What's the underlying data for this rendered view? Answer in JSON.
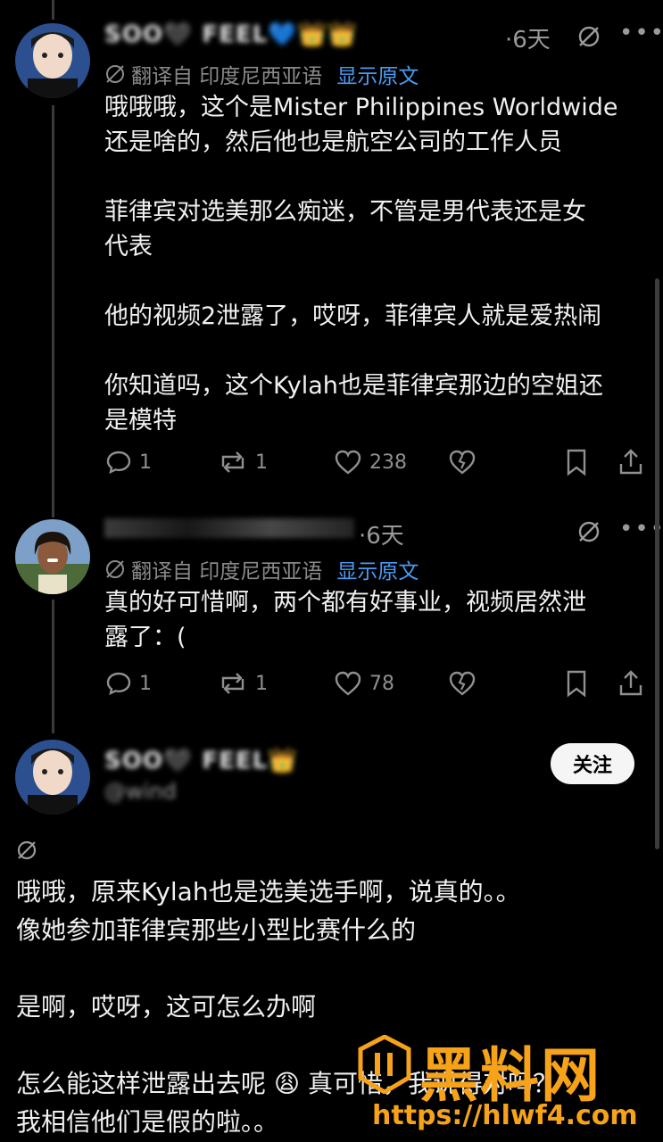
{
  "posts": [
    {
      "author": "SOO🖤 FEEL💙👑👑",
      "time": "·6天",
      "translate_label": "翻译自 印度尼西亚语",
      "show_original": "显示原文",
      "text": "哦哦哦，这个是Mister Philippines Worldwide\n还是啥的，然后他也是航空公司的工作人员\n\n菲律宾对选美那么痴迷，不管是男代表还是女\n代表\n\n他的视频2泄露了，哎呀，菲律宾人就是爱热闹\n\n你知道吗，这个Kylah也是菲律宾那边的空姐还\n是模特",
      "replies": "1",
      "reposts": "1",
      "likes": "238"
    },
    {
      "author": "",
      "time": "·6天",
      "translate_label": "翻译自 印度尼西亚语",
      "show_original": "显示原文",
      "text": "真的好可惜啊，两个都有好事业，视频居然泄\n露了：(",
      "replies": "1",
      "reposts": "1",
      "likes": "78"
    }
  ],
  "focus_post": {
    "author": "SOO🖤 FEEL👑",
    "handle": "@wind",
    "follow_label": "关注",
    "text": "哦哦，原来Kylah也是选美选手啊，说真的。。\n像她参加菲律宾那些小型比赛什么的\n\n是啊，哎呀，这可怎么办啊\n\n怎么能这样泄露出去呢 😩 真可惜，我说得对吗？\n我相信他们是假的啦。。"
  },
  "watermark": {
    "title": "黑料网",
    "url": "https://hlwf4.com"
  },
  "colors": {
    "link": "#4a9bf5",
    "accent": "#f6a31a",
    "muted": "#9a9a9a"
  }
}
